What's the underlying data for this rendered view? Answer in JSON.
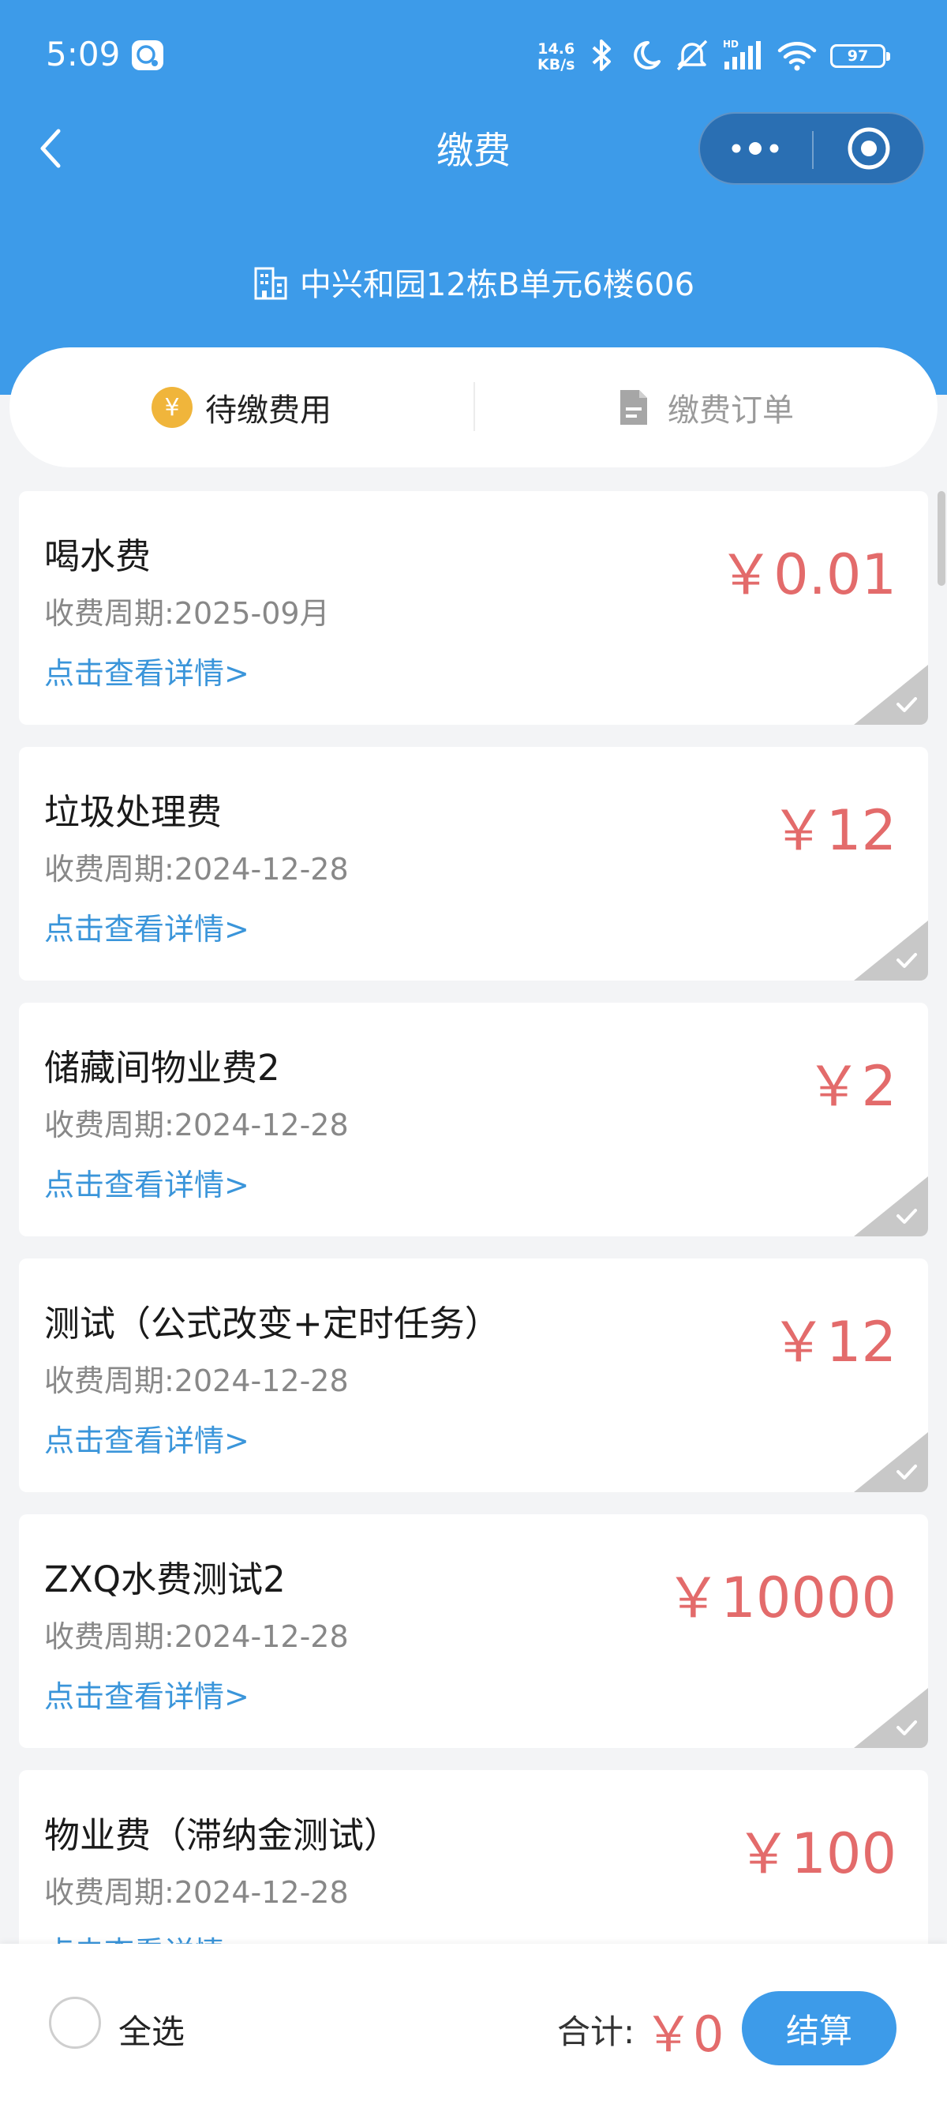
{
  "status_bar": {
    "time": "5:09",
    "net_speed_value": "14.6",
    "net_speed_unit": "KB/s",
    "battery": "97"
  },
  "nav": {
    "title": "缴费"
  },
  "address": "中兴和园12栋B单元6楼606",
  "tabs": [
    {
      "label": "待缴费用",
      "active": true
    },
    {
      "label": "缴费订单",
      "active": false
    }
  ],
  "fees": [
    {
      "name": "喝水费",
      "period": "收费周期:2025-09月",
      "amount": "￥0.01",
      "link": "点击查看详情>"
    },
    {
      "name": "垃圾处理费",
      "period": "收费周期:2024-12-28",
      "amount": "￥12",
      "link": "点击查看详情>"
    },
    {
      "name": "储藏间物业费2",
      "period": "收费周期:2024-12-28",
      "amount": "￥2",
      "link": "点击查看详情>"
    },
    {
      "name": "测试（公式改变+定时任务）",
      "period": "收费周期:2024-12-28",
      "amount": "￥12",
      "link": "点击查看详情>"
    },
    {
      "name": "ZXQ水费测试2",
      "period": "收费周期:2024-12-28",
      "amount": "￥10000",
      "link": "点击查看详情>"
    },
    {
      "name": "物业费（滞纳金测试）",
      "period": "收费周期:2024-12-28",
      "amount": "￥100",
      "link": "点击查看详情>"
    }
  ],
  "footer": {
    "select_all": "全选",
    "total_label": "合计:",
    "total_amount": "￥0",
    "checkout": "结算"
  },
  "colors": {
    "primary": "#3d9be9",
    "amount": "#e36b6b",
    "link": "#3a95da",
    "coin": "#f0b53b"
  }
}
